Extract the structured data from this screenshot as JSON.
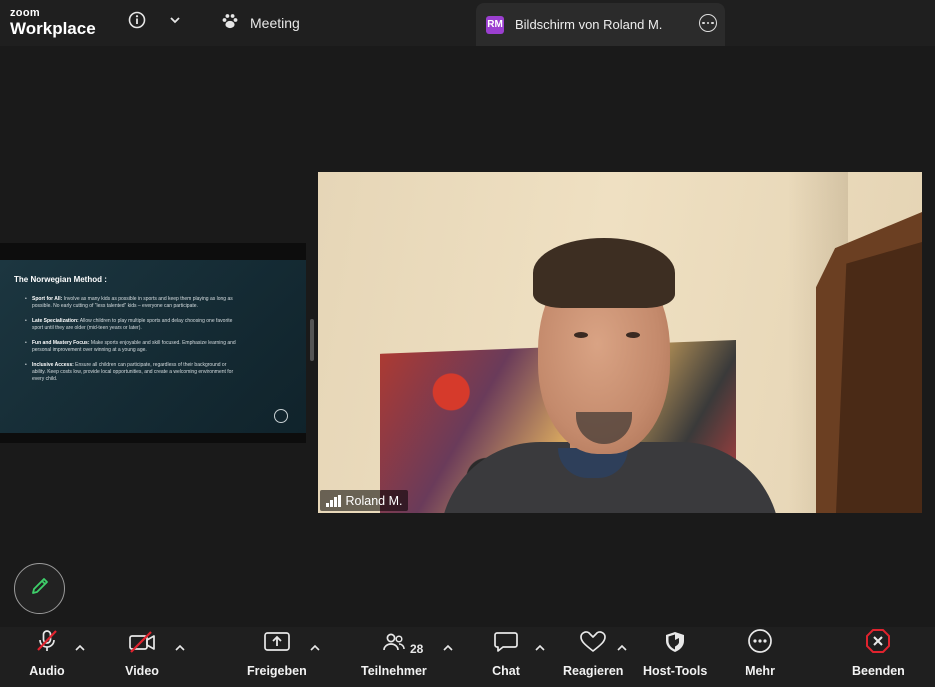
{
  "app": {
    "logo_line1": "zoom",
    "logo_line2": "Workplace",
    "accent_color": "#9b3fd0"
  },
  "top_bar": {
    "meeting_label": "Meeting",
    "share_tab": {
      "avatar_initials": "RM",
      "label": "Bildschirm von Roland M."
    }
  },
  "slide": {
    "title": "The Norwegian Method :",
    "items": [
      {
        "heading": "Sport for All:",
        "text": " Involve as many kids as possible in sports and keep them playing as long as possible. No early cutting of “less talented” kids – everyone can participate."
      },
      {
        "heading": "Late Specialization:",
        "text": " Allow children to play multiple sports and delay choosing one favorite sport until they are older (mid-teen years or later)."
      },
      {
        "heading": "Fun and Mastery Focus:",
        "text": " Make sports enjoyable and skill focused. Emphasize learning and personal improvement over winning at a young age."
      },
      {
        "heading": "Inclusive Access:",
        "text": " Ensure all children can participate, regardless of their background or ability. Keep costs low, provide local opportunities, and create a welcoming environment for every child."
      }
    ]
  },
  "video": {
    "participant_name": "Roland M."
  },
  "toolbar": {
    "audio_label": "Audio",
    "video_label": "Video",
    "share_label": "Freigeben",
    "participants_label": "Teilnehmer",
    "participants_count": "28",
    "chat_label": "Chat",
    "react_label": "Reagieren",
    "host_tools_label": "Host-Tools",
    "more_label": "Mehr",
    "end_label": "Beenden"
  }
}
